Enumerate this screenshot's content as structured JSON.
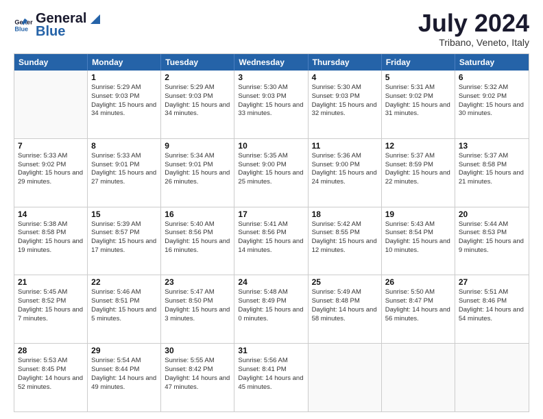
{
  "logo": {
    "line1": "General",
    "line2": "Blue"
  },
  "title": "July 2024",
  "location": "Tribano, Veneto, Italy",
  "header_days": [
    "Sunday",
    "Monday",
    "Tuesday",
    "Wednesday",
    "Thursday",
    "Friday",
    "Saturday"
  ],
  "weeks": [
    [
      {
        "day": "",
        "empty": true
      },
      {
        "day": "1",
        "sunrise": "5:29 AM",
        "sunset": "9:03 PM",
        "daylight": "15 hours and 34 minutes."
      },
      {
        "day": "2",
        "sunrise": "5:29 AM",
        "sunset": "9:03 PM",
        "daylight": "15 hours and 34 minutes."
      },
      {
        "day": "3",
        "sunrise": "5:30 AM",
        "sunset": "9:03 PM",
        "daylight": "15 hours and 33 minutes."
      },
      {
        "day": "4",
        "sunrise": "5:30 AM",
        "sunset": "9:03 PM",
        "daylight": "15 hours and 32 minutes."
      },
      {
        "day": "5",
        "sunrise": "5:31 AM",
        "sunset": "9:02 PM",
        "daylight": "15 hours and 31 minutes."
      },
      {
        "day": "6",
        "sunrise": "5:32 AM",
        "sunset": "9:02 PM",
        "daylight": "15 hours and 30 minutes."
      }
    ],
    [
      {
        "day": "7",
        "sunrise": "5:33 AM",
        "sunset": "9:02 PM",
        "daylight": "15 hours and 29 minutes."
      },
      {
        "day": "8",
        "sunrise": "5:33 AM",
        "sunset": "9:01 PM",
        "daylight": "15 hours and 27 minutes."
      },
      {
        "day": "9",
        "sunrise": "5:34 AM",
        "sunset": "9:01 PM",
        "daylight": "15 hours and 26 minutes."
      },
      {
        "day": "10",
        "sunrise": "5:35 AM",
        "sunset": "9:00 PM",
        "daylight": "15 hours and 25 minutes."
      },
      {
        "day": "11",
        "sunrise": "5:36 AM",
        "sunset": "9:00 PM",
        "daylight": "15 hours and 24 minutes."
      },
      {
        "day": "12",
        "sunrise": "5:37 AM",
        "sunset": "8:59 PM",
        "daylight": "15 hours and 22 minutes."
      },
      {
        "day": "13",
        "sunrise": "5:37 AM",
        "sunset": "8:58 PM",
        "daylight": "15 hours and 21 minutes."
      }
    ],
    [
      {
        "day": "14",
        "sunrise": "5:38 AM",
        "sunset": "8:58 PM",
        "daylight": "15 hours and 19 minutes."
      },
      {
        "day": "15",
        "sunrise": "5:39 AM",
        "sunset": "8:57 PM",
        "daylight": "15 hours and 17 minutes."
      },
      {
        "day": "16",
        "sunrise": "5:40 AM",
        "sunset": "8:56 PM",
        "daylight": "15 hours and 16 minutes."
      },
      {
        "day": "17",
        "sunrise": "5:41 AM",
        "sunset": "8:56 PM",
        "daylight": "15 hours and 14 minutes."
      },
      {
        "day": "18",
        "sunrise": "5:42 AM",
        "sunset": "8:55 PM",
        "daylight": "15 hours and 12 minutes."
      },
      {
        "day": "19",
        "sunrise": "5:43 AM",
        "sunset": "8:54 PM",
        "daylight": "15 hours and 10 minutes."
      },
      {
        "day": "20",
        "sunrise": "5:44 AM",
        "sunset": "8:53 PM",
        "daylight": "15 hours and 9 minutes."
      }
    ],
    [
      {
        "day": "21",
        "sunrise": "5:45 AM",
        "sunset": "8:52 PM",
        "daylight": "15 hours and 7 minutes."
      },
      {
        "day": "22",
        "sunrise": "5:46 AM",
        "sunset": "8:51 PM",
        "daylight": "15 hours and 5 minutes."
      },
      {
        "day": "23",
        "sunrise": "5:47 AM",
        "sunset": "8:50 PM",
        "daylight": "15 hours and 3 minutes."
      },
      {
        "day": "24",
        "sunrise": "5:48 AM",
        "sunset": "8:49 PM",
        "daylight": "15 hours and 0 minutes."
      },
      {
        "day": "25",
        "sunrise": "5:49 AM",
        "sunset": "8:48 PM",
        "daylight": "14 hours and 58 minutes."
      },
      {
        "day": "26",
        "sunrise": "5:50 AM",
        "sunset": "8:47 PM",
        "daylight": "14 hours and 56 minutes."
      },
      {
        "day": "27",
        "sunrise": "5:51 AM",
        "sunset": "8:46 PM",
        "daylight": "14 hours and 54 minutes."
      }
    ],
    [
      {
        "day": "28",
        "sunrise": "5:53 AM",
        "sunset": "8:45 PM",
        "daylight": "14 hours and 52 minutes."
      },
      {
        "day": "29",
        "sunrise": "5:54 AM",
        "sunset": "8:44 PM",
        "daylight": "14 hours and 49 minutes."
      },
      {
        "day": "30",
        "sunrise": "5:55 AM",
        "sunset": "8:42 PM",
        "daylight": "14 hours and 47 minutes."
      },
      {
        "day": "31",
        "sunrise": "5:56 AM",
        "sunset": "8:41 PM",
        "daylight": "14 hours and 45 minutes."
      },
      {
        "day": "",
        "empty": true
      },
      {
        "day": "",
        "empty": true
      },
      {
        "day": "",
        "empty": true
      }
    ]
  ]
}
